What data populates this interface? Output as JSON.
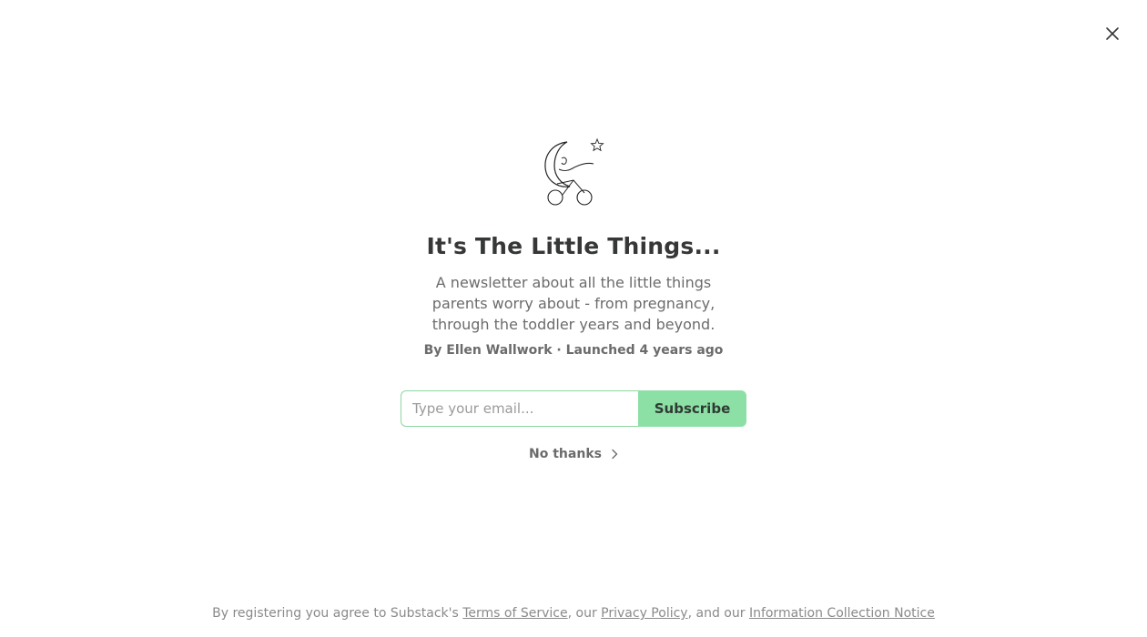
{
  "modal": {
    "close_icon": "close-icon",
    "logo_icon": "moon-stroller-logo",
    "title": "It's The Little Things...",
    "description": "A newsletter about all the little things parents worry about - from pregnancy, through the toddler years and beyond.",
    "byline": "By Ellen Wallwork · Launched 4 years ago",
    "email_placeholder": "Type your email...",
    "email_value": "",
    "subscribe_label": "Subscribe",
    "no_thanks_label": "No thanks",
    "no_thanks_icon": "chevron-right-icon"
  },
  "footer": {
    "prefix": "By registering you agree to Substack's ",
    "terms_label": "Terms of Service",
    "sep1": ", our ",
    "privacy_label": "Privacy Policy",
    "sep2": ", and our ",
    "notice_label": "Information Collection Notice"
  },
  "colors": {
    "accent": "#8ce0a6",
    "input_border": "#8ed6a0",
    "title_text": "#363737",
    "muted_text": "#6b6b6b"
  }
}
